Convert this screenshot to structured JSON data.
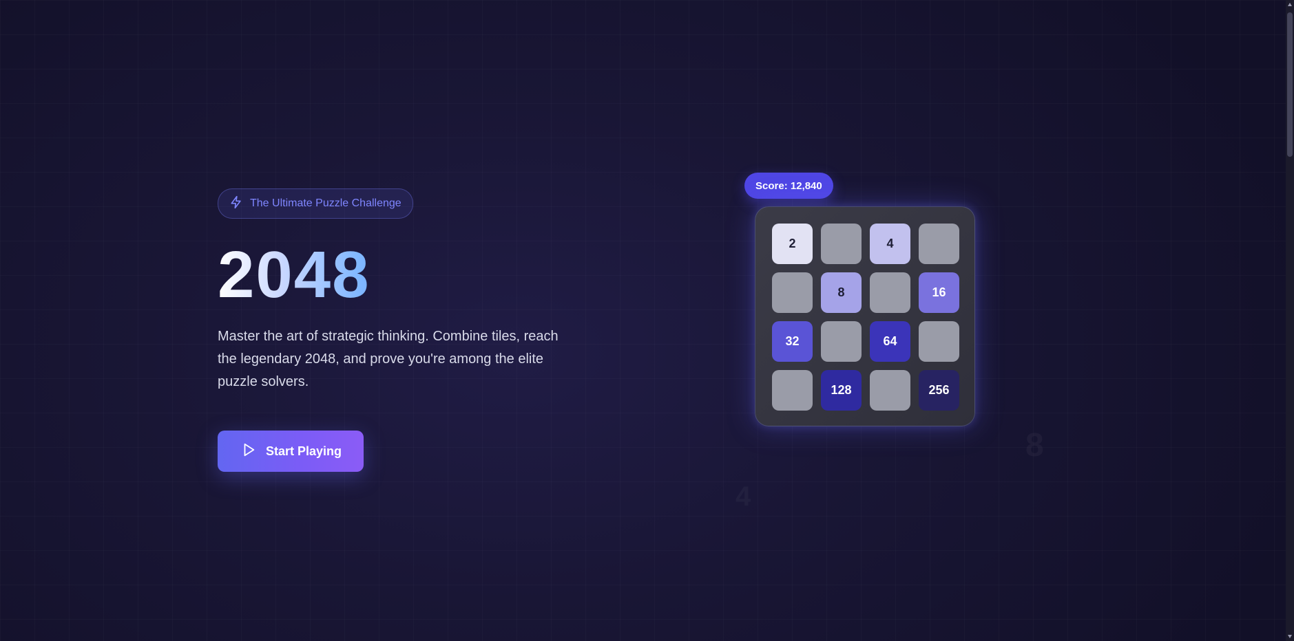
{
  "hero": {
    "badge_label": "The Ultimate Puzzle Challenge",
    "badge_icon": "lightning-icon",
    "title": "2048",
    "description": "Master the art of strategic thinking. Combine tiles, reach the legendary 2048, and prove you're among the elite puzzle solvers.",
    "cta_label": "Start Playing",
    "cta_icon": "play-icon"
  },
  "board": {
    "score_label": "Score: 12,840",
    "tiles": [
      {
        "value": "2",
        "bg": "#e2e2f3",
        "fg": "#1e1e35"
      },
      {
        "value": "",
        "bg": "#9a9ca8",
        "fg": "#1e1e35"
      },
      {
        "value": "4",
        "bg": "#c2c1ee",
        "fg": "#1e1e35"
      },
      {
        "value": "",
        "bg": "#9a9ca8",
        "fg": "#1e1e35"
      },
      {
        "value": "",
        "bg": "#9a9ca8",
        "fg": "#1e1e35"
      },
      {
        "value": "8",
        "bg": "#a5a3e8",
        "fg": "#1e1e35"
      },
      {
        "value": "",
        "bg": "#9a9ca8",
        "fg": "#1e1e35"
      },
      {
        "value": "16",
        "bg": "#7a72de",
        "fg": "#ffffff"
      },
      {
        "value": "32",
        "bg": "#5a54d6",
        "fg": "#ffffff"
      },
      {
        "value": "",
        "bg": "#9a9ca8",
        "fg": "#1e1e35"
      },
      {
        "value": "64",
        "bg": "#3b34b9",
        "fg": "#ffffff"
      },
      {
        "value": "",
        "bg": "#9a9ca8",
        "fg": "#1e1e35"
      },
      {
        "value": "",
        "bg": "#9a9ca8",
        "fg": "#1e1e35"
      },
      {
        "value": "128",
        "bg": "#2f2aa0",
        "fg": "#ffffff"
      },
      {
        "value": "",
        "bg": "#9a9ca8",
        "fg": "#1e1e35"
      },
      {
        "value": "256",
        "bg": "#272362",
        "fg": "#ffffff"
      }
    ]
  },
  "colors": {
    "accent": "#6366f1",
    "accent_purple": "#8b5cf6",
    "background": "#191635"
  }
}
